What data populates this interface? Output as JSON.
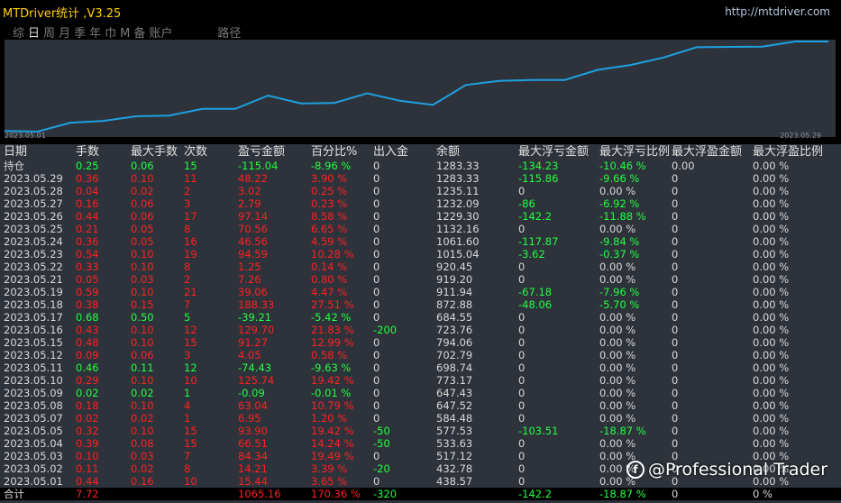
{
  "app": {
    "title": "MTDriver统计 ,V3.25",
    "url": "http://mtdriver.com",
    "tabs": [
      "综",
      "日",
      "周",
      "月",
      "季",
      "年",
      "巾",
      "M",
      "备",
      "账户"
    ],
    "active_tab": 1,
    "extra_tab": "路径"
  },
  "chart": {
    "start_date": "2023.05.01",
    "end_date": "2023.05.29",
    "line_color": "#1ea0e0",
    "balance_series": [
      438.57,
      432.78,
      517.12,
      533.63,
      577.53,
      584.48,
      647.52,
      647.43,
      773.17,
      698.74,
      702.79,
      794.06,
      723.76,
      684.55,
      872.88,
      911.94,
      919.2,
      920.45,
      1015.04,
      1061.6,
      1132.16,
      1229.3,
      1232.09,
      1235.11,
      1283.33,
      1283.33
    ]
  },
  "columns": [
    "日期",
    "手数",
    "最大手数",
    "次数",
    "盈亏金额",
    "百分比%",
    "出入金",
    "余额",
    "最大浮亏金额",
    "最大浮亏比例",
    "最大浮盈金额",
    "最大浮盈比例"
  ],
  "rows": [
    {
      "date": "持仓",
      "lots": "0.25",
      "maxlots": "0.06",
      "count": "15",
      "pnl": "-115.04",
      "pct": "-8.96 %",
      "io": "0",
      "bal": "1283.33",
      "fl": "-134.23",
      "flp": "-10.46 %",
      "fp": "0.00",
      "fpp": "0.00 %",
      "c": "g"
    },
    {
      "date": "2023.05.29",
      "lots": "0.36",
      "maxlots": "0.10",
      "count": "11",
      "pnl": "48.22",
      "pct": "3.90 %",
      "io": "0",
      "bal": "1283.33",
      "fl": "-115.86",
      "flp": "-9.66 %",
      "fp": "0",
      "fpp": "0.00 %",
      "c": "r"
    },
    {
      "date": "2023.05.28",
      "lots": "0.04",
      "maxlots": "0.02",
      "count": "2",
      "pnl": "3.02",
      "pct": "0.25 %",
      "io": "0",
      "bal": "1235.11",
      "fl": "0",
      "flp": "0.00 %",
      "fp": "0",
      "fpp": "0.00 %",
      "c": "r"
    },
    {
      "date": "2023.05.27",
      "lots": "0.16",
      "maxlots": "0.06",
      "count": "3",
      "pnl": "2.79",
      "pct": "0.23 %",
      "io": "0",
      "bal": "1232.09",
      "fl": "-86",
      "flp": "-6.92 %",
      "fp": "0",
      "fpp": "0.00 %",
      "c": "r"
    },
    {
      "date": "2023.05.26",
      "lots": "0.44",
      "maxlots": "0.06",
      "count": "17",
      "pnl": "97.14",
      "pct": "8.58 %",
      "io": "0",
      "bal": "1229.30",
      "fl": "-142.2",
      "flp": "-11.88 %",
      "fp": "0",
      "fpp": "0.00 %",
      "c": "r"
    },
    {
      "date": "2023.05.25",
      "lots": "0.21",
      "maxlots": "0.05",
      "count": "8",
      "pnl": "70.56",
      "pct": "6.65 %",
      "io": "0",
      "bal": "1132.16",
      "fl": "0",
      "flp": "0.00 %",
      "fp": "0",
      "fpp": "0.00 %",
      "c": "r"
    },
    {
      "date": "2023.05.24",
      "lots": "0.36",
      "maxlots": "0.05",
      "count": "16",
      "pnl": "46.56",
      "pct": "4.59 %",
      "io": "0",
      "bal": "1061.60",
      "fl": "-117.87",
      "flp": "-9.84 %",
      "fp": "0",
      "fpp": "0.00 %",
      "c": "r"
    },
    {
      "date": "2023.05.23",
      "lots": "0.54",
      "maxlots": "0.10",
      "count": "19",
      "pnl": "94.59",
      "pct": "10.28 %",
      "io": "0",
      "bal": "1015.04",
      "fl": "-3.62",
      "flp": "-0.37 %",
      "fp": "0",
      "fpp": "0.00 %",
      "c": "r"
    },
    {
      "date": "2023.05.22",
      "lots": "0.33",
      "maxlots": "0.10",
      "count": "8",
      "pnl": "1.25",
      "pct": "0.14 %",
      "io": "0",
      "bal": "920.45",
      "fl": "0",
      "flp": "0.00 %",
      "fp": "0",
      "fpp": "0.00 %",
      "c": "r"
    },
    {
      "date": "2023.05.21",
      "lots": "0.05",
      "maxlots": "0.03",
      "count": "2",
      "pnl": "7.26",
      "pct": "0.80 %",
      "io": "0",
      "bal": "919.20",
      "fl": "0",
      "flp": "0.00 %",
      "fp": "0",
      "fpp": "0.00 %",
      "c": "r"
    },
    {
      "date": "2023.05.19",
      "lots": "0.59",
      "maxlots": "0.10",
      "count": "21",
      "pnl": "39.06",
      "pct": "4.47 %",
      "io": "0",
      "bal": "911.94",
      "fl": "-67.18",
      "flp": "-7.96 %",
      "fp": "0",
      "fpp": "0.00 %",
      "c": "r"
    },
    {
      "date": "2023.05.18",
      "lots": "0.38",
      "maxlots": "0.15",
      "count": "7",
      "pnl": "188.33",
      "pct": "27.51 %",
      "io": "0",
      "bal": "872.88",
      "fl": "-48.06",
      "flp": "-5.70 %",
      "fp": "0",
      "fpp": "0.00 %",
      "c": "r"
    },
    {
      "date": "2023.05.17",
      "lots": "0.68",
      "maxlots": "0.50",
      "count": "5",
      "pnl": "-39.21",
      "pct": "-5.42 %",
      "io": "0",
      "bal": "684.55",
      "fl": "0",
      "flp": "0.00 %",
      "fp": "0",
      "fpp": "0.00 %",
      "c": "g"
    },
    {
      "date": "2023.05.16",
      "lots": "0.43",
      "maxlots": "0.10",
      "count": "12",
      "pnl": "129.70",
      "pct": "21.83 %",
      "io": "-200",
      "bal": "723.76",
      "fl": "0",
      "flp": "0.00 %",
      "fp": "0",
      "fpp": "0.00 %",
      "c": "r",
      "ioc": "g"
    },
    {
      "date": "2023.05.15",
      "lots": "0.48",
      "maxlots": "0.10",
      "count": "15",
      "pnl": "91.27",
      "pct": "12.99 %",
      "io": "0",
      "bal": "794.06",
      "fl": "0",
      "flp": "0.00 %",
      "fp": "0",
      "fpp": "0.00 %",
      "c": "r"
    },
    {
      "date": "2023.05.12",
      "lots": "0.09",
      "maxlots": "0.06",
      "count": "3",
      "pnl": "4.05",
      "pct": "0.58 %",
      "io": "0",
      "bal": "702.79",
      "fl": "0",
      "flp": "0.00 %",
      "fp": "0",
      "fpp": "0.00 %",
      "c": "r"
    },
    {
      "date": "2023.05.11",
      "lots": "0.46",
      "maxlots": "0.11",
      "count": "12",
      "pnl": "-74.43",
      "pct": "-9.63 %",
      "io": "0",
      "bal": "698.74",
      "fl": "0",
      "flp": "0.00 %",
      "fp": "0",
      "fpp": "0.00 %",
      "c": "g"
    },
    {
      "date": "2023.05.10",
      "lots": "0.29",
      "maxlots": "0.10",
      "count": "10",
      "pnl": "125.74",
      "pct": "19.42 %",
      "io": "0",
      "bal": "773.17",
      "fl": "0",
      "flp": "0.00 %",
      "fp": "0",
      "fpp": "0.00 %",
      "c": "r"
    },
    {
      "date": "2023.05.09",
      "lots": "0.02",
      "maxlots": "0.02",
      "count": "1",
      "pnl": "-0.09",
      "pct": "-0.01 %",
      "io": "0",
      "bal": "647.43",
      "fl": "0",
      "flp": "0.00 %",
      "fp": "0",
      "fpp": "0.00 %",
      "c": "g"
    },
    {
      "date": "2023.05.08",
      "lots": "0.18",
      "maxlots": "0.10",
      "count": "4",
      "pnl": "63.04",
      "pct": "10.79 %",
      "io": "0",
      "bal": "647.52",
      "fl": "0",
      "flp": "0.00 %",
      "fp": "0",
      "fpp": "0.00 %",
      "c": "r"
    },
    {
      "date": "2023.05.07",
      "lots": "0.02",
      "maxlots": "0.02",
      "count": "1",
      "pnl": "6.95",
      "pct": "1.20 %",
      "io": "0",
      "bal": "584.48",
      "fl": "0",
      "flp": "0.00 %",
      "fp": "0",
      "fpp": "0.00 %",
      "c": "r"
    },
    {
      "date": "2023.05.05",
      "lots": "0.32",
      "maxlots": "0.10",
      "count": "15",
      "pnl": "93.90",
      "pct": "19.42 %",
      "io": "-50",
      "bal": "577.53",
      "fl": "-103.51",
      "flp": "-18.87 %",
      "fp": "0",
      "fpp": "0.00 %",
      "c": "r",
      "ioc": "g"
    },
    {
      "date": "2023.05.04",
      "lots": "0.39",
      "maxlots": "0.08",
      "count": "15",
      "pnl": "66.51",
      "pct": "14.24 %",
      "io": "-50",
      "bal": "533.63",
      "fl": "0",
      "flp": "0.00 %",
      "fp": "0",
      "fpp": "0.00 %",
      "c": "r",
      "ioc": "g"
    },
    {
      "date": "2023.05.03",
      "lots": "0.10",
      "maxlots": "0.03",
      "count": "7",
      "pnl": "84.34",
      "pct": "19.49 %",
      "io": "0",
      "bal": "517.12",
      "fl": "0",
      "flp": "0.00 %",
      "fp": "0",
      "fpp": "0.00 %",
      "c": "r"
    },
    {
      "date": "2023.05.02",
      "lots": "0.11",
      "maxlots": "0.02",
      "count": "8",
      "pnl": "14.21",
      "pct": "3.39 %",
      "io": "-20",
      "bal": "432.78",
      "fl": "0",
      "flp": "0.00 %",
      "fp": "0",
      "fpp": "0.00 %",
      "c": "r",
      "ioc": "g"
    },
    {
      "date": "2023.05.01",
      "lots": "0.44",
      "maxlots": "0.16",
      "count": "10",
      "pnl": "15.44",
      "pct": "3.65 %",
      "io": "0",
      "bal": "438.57",
      "fl": "0",
      "flp": "0.00 %",
      "fp": "0",
      "fpp": "0.00 %",
      "c": "r"
    }
  ],
  "total": {
    "date": "合计",
    "lots": "7.72",
    "maxlots": "",
    "count": "",
    "pnl": "1065.16",
    "pct": "170.36 %",
    "io": "-320",
    "bal": "",
    "fl": "-142.2",
    "flp": "-18.87 %",
    "fp": "0",
    "fpp": "0 %"
  },
  "watermark": "@Professional Trader",
  "watermark_icon": "f"
}
